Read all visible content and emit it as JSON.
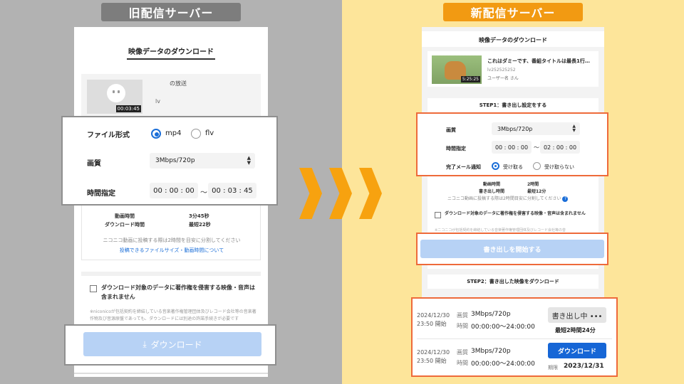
{
  "old": {
    "banner": "旧配信サーバー",
    "page_title": "映像データのダウンロード",
    "card": {
      "title": "の放送",
      "sub": "lv",
      "duration": "00:03:45"
    },
    "format": {
      "label": "ファイル形式",
      "opt1": "mp4",
      "opt2": "flv",
      "selected": "mp4"
    },
    "quality": {
      "label": "画質",
      "value": "3Mbps/720p"
    },
    "time": {
      "label": "時間指定",
      "start": "00 : 00 : 00",
      "sep": "～",
      "end": "00 : 03 : 45"
    },
    "info": {
      "video_len_label": "動画時間",
      "video_len_value": "3分45秒",
      "dl_time_label": "ダウンロード時間",
      "dl_time_value": "最短22秒",
      "note": "ニコニコ動画に投稿する際は2時間を目安に分割してください",
      "link": "投稿できるファイルサイズ・動画時間について"
    },
    "copyright": {
      "text": "ダウンロード対象のデータに著作権を侵害する映像・音声は含まれません",
      "note": "※niconicoが包括契約を締結している音楽著作権管理団体及びレコード会社等の音楽著作物及び音源原盤であっても、ダウンロードには別途の許諾手続きが必要です"
    },
    "download_btn": "ダウンロード"
  },
  "new": {
    "banner": "新配信サーバー",
    "page_title": "映像データのダウンロード",
    "card": {
      "title": "これはダミーです、番組タイトルは最長1行…",
      "id": "lv252525252",
      "user": "ユーザー名 さん",
      "duration": "5:25:25"
    },
    "step1": "STEP1：書き出し設定をする",
    "quality": {
      "label": "画質",
      "value": "3Mbps/720p"
    },
    "time": {
      "label": "時間指定",
      "start": "00 : 00 : 00",
      "sep": "～",
      "end": "02 : 00 : 00"
    },
    "mail": {
      "label": "完了メール通知",
      "opt1": "受け取る",
      "opt2": "受け取らない",
      "selected": "受け取る"
    },
    "info": {
      "video_len_label": "動画時間",
      "video_len_value": "2時間",
      "export_len_label": "書き出し時間",
      "export_len_value": "最短12分",
      "note": "ニコニコ動画に投稿する際は2時間目安に分割してください"
    },
    "copyright": {
      "text": "ダウンロード対象のデータに著作権を侵害する映像・音声は含まれません",
      "note": "※ニコニコが包括契約を締結している音楽著作権管理団体及びレコード会社等の音"
    },
    "start_btn": "書き出しを開始する",
    "step2": "STEP2：書き出した映像をダウンロード",
    "rows": [
      {
        "date": "2024/12/30",
        "start": "23:50 開始",
        "q_label": "画質",
        "q_value": "3Mbps/720p",
        "t_label": "時間",
        "t_value": "00:00:00～24:00:00",
        "btn": "書き出し中 •••",
        "extra": "最短2時間24分"
      },
      {
        "date": "2024/12/30",
        "start": "23:50 開始",
        "q_label": "画質",
        "q_value": "3Mbps/720p",
        "t_label": "時間",
        "t_value": "00:00:00～24:00:00",
        "btn": "ダウンロード",
        "exp_label": "期限",
        "exp_value": "2023/12/31"
      }
    ]
  },
  "colors": {
    "old_banner": "#7d7d7d",
    "new_banner": "#f29a12",
    "highlight": "#ee6a3a",
    "accent": "#1666d6",
    "arrow": "#f7a20f"
  }
}
